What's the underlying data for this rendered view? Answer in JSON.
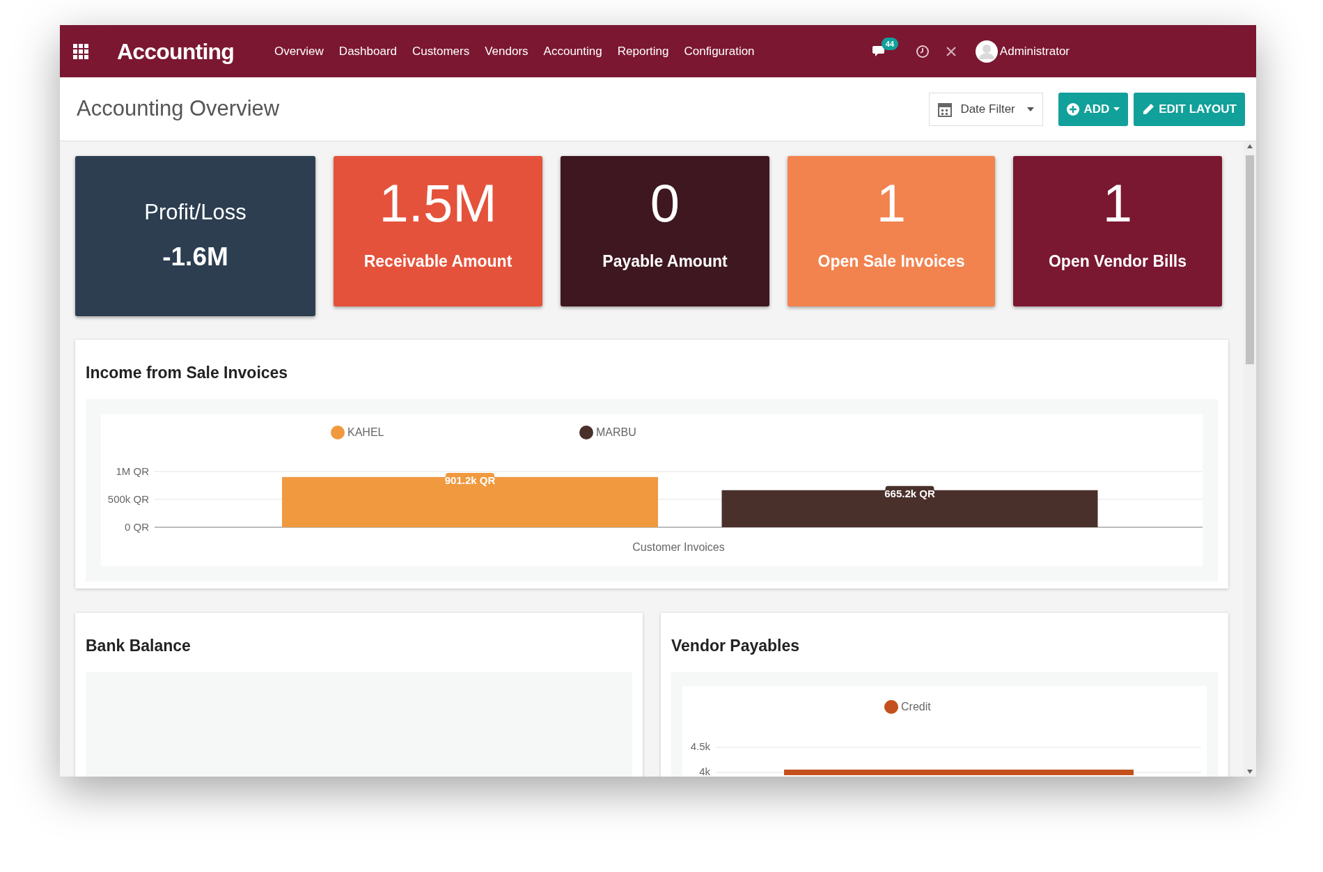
{
  "navbar": {
    "app_title": "Accounting",
    "menu": [
      "Overview",
      "Dashboard",
      "Customers",
      "Vendors",
      "Accounting",
      "Reporting",
      "Configuration"
    ],
    "messages_badge": "44",
    "user": "Administrator"
  },
  "header": {
    "title": "Accounting Overview",
    "date_filter": "Date Filter",
    "buttons": [
      {
        "label": "ADD",
        "kind": "add"
      },
      {
        "label": "EDIT LAYOUT",
        "kind": "edit"
      }
    ]
  },
  "kpis": [
    {
      "kind": "titled",
      "label": "Profit/Loss",
      "value": "-1.6M",
      "color": "#2c3e50"
    },
    {
      "kind": "big",
      "number": "1.5M",
      "caption": "Receivable Amount",
      "color": "#e5523b"
    },
    {
      "kind": "big",
      "number": "0",
      "caption": "Payable Amount",
      "color": "#3e1720"
    },
    {
      "kind": "big",
      "number": "1",
      "caption": "Open Sale Invoices",
      "color": "#f2834f"
    },
    {
      "kind": "big",
      "number": "1",
      "caption": "Open Vendor Bills",
      "color": "#7a1731"
    }
  ],
  "income": {
    "title": "Income from Sale Invoices",
    "chart_data": {
      "type": "bar",
      "legend": "top",
      "categories": [
        "Customer Invoices"
      ],
      "series": [
        {
          "name": "KAHEL",
          "color": "#f0993e",
          "values": [
            901200
          ]
        },
        {
          "name": "MARBU",
          "color": "#4a302b",
          "values": [
            665200
          ]
        }
      ],
      "ylim": [
        0,
        1000000
      ],
      "yticks": [
        {
          "value": 0,
          "label": "0 QR"
        },
        {
          "value": 500000,
          "label": "500k QR"
        },
        {
          "value": 1000000,
          "label": "1M QR"
        }
      ],
      "value_labels": [
        "901.2k QR",
        "665.2k QR"
      ]
    }
  },
  "bank_balance": {
    "title": "Bank Balance"
  },
  "vendor_payables": {
    "title": "Vendor Payables",
    "chart": {
      "legend": [
        {
          "name": "Credit",
          "color": "#c4501e"
        }
      ],
      "y_axis_labels": [
        "4.5k",
        "4k"
      ]
    }
  }
}
